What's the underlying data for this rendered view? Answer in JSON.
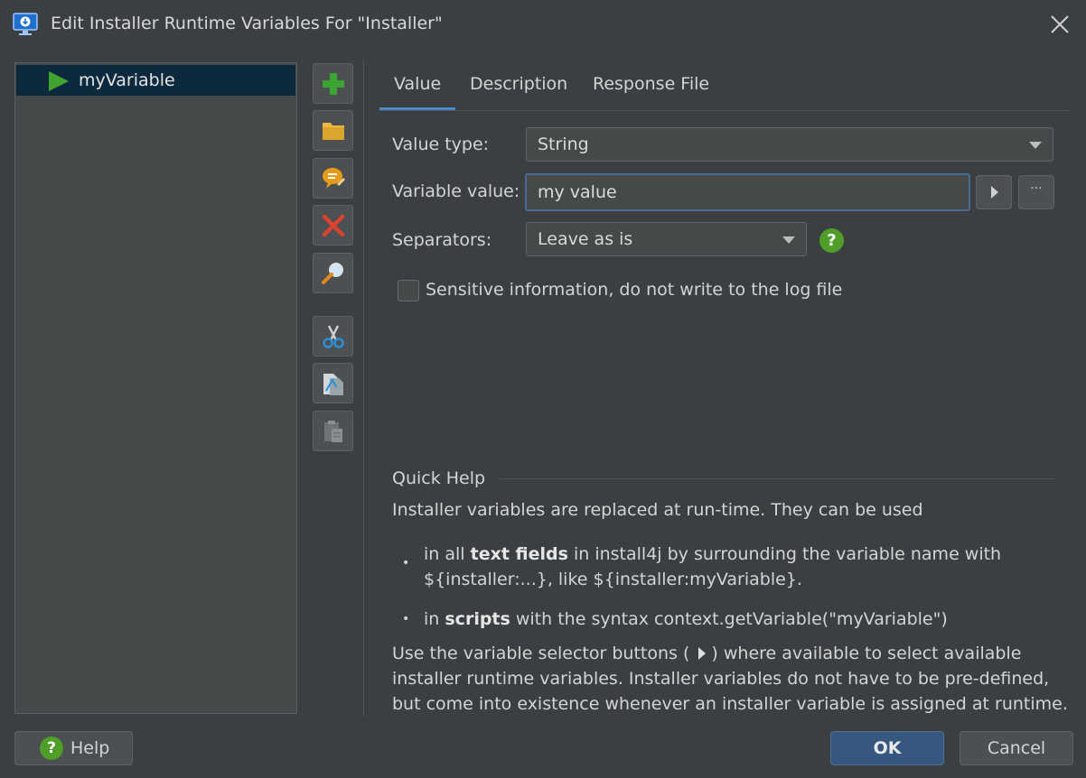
{
  "window": {
    "title": "Edit Installer Runtime Variables For \"Installer\""
  },
  "tree": {
    "items": [
      {
        "label": "myVariable"
      }
    ]
  },
  "toolbar": {
    "icons": [
      "add-icon",
      "folder-icon",
      "comment-icon",
      "delete-icon",
      "search-icon",
      "cut-icon",
      "copy-icon",
      "paste-icon"
    ]
  },
  "tabs": [
    {
      "label": "Value",
      "selected": true
    },
    {
      "label": "Description",
      "selected": false
    },
    {
      "label": "Response File",
      "selected": false
    }
  ],
  "form": {
    "value_type_label": "Value type:",
    "value_type_selected": "String",
    "variable_value_label": "Variable value:",
    "variable_value": "my value",
    "ellipsis_label": "···",
    "separators_label": "Separators:",
    "separators_selected": "Leave as is",
    "help_glyph": "?",
    "sensitive_label": "Sensitive information, do not write to the log file",
    "sensitive_checked": false
  },
  "quick_help": {
    "title": "Quick Help",
    "intro": "Installer variables are replaced at run-time. They can be used",
    "bullet1_pre": "in all ",
    "bullet1_bold": "text fields",
    "bullet1_post": " in install4j by surrounding the variable name with",
    "bullet1_line2": "${installer:...}, like ${installer:myVariable}.",
    "bullet2_pre": "in ",
    "bullet2_bold": "scripts",
    "bullet2_post": " with the syntax context.getVariable(\"myVariable\")",
    "outro_line1_pre": "Use the variable selector buttons (",
    "outro_line1_post": ") where available to select available",
    "outro_line2": "installer runtime variables. Installer variables do not have to be pre-defined,",
    "outro_line3": "but come into existence whenever an installer variable is assigned at runtime."
  },
  "footer": {
    "help_label": "Help",
    "ok_label": "OK",
    "cancel_label": "Cancel"
  },
  "colors": {
    "background": "#3c3f41",
    "selection": "#0d293e",
    "accent": "#4a88c7",
    "ok_button": "#365880",
    "green": "#4f9e2a"
  }
}
